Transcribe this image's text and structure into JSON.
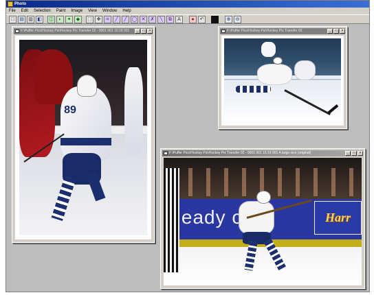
{
  "app": {
    "title": "Photo",
    "menu": [
      "File",
      "Edit",
      "Selection",
      "Paint",
      "Image",
      "View",
      "Window",
      "Help"
    ]
  },
  "toolbar": {
    "buttons": [
      {
        "icon": "new-icon",
        "glyph": "□"
      },
      {
        "icon": "open-icon",
        "glyph": "▤"
      },
      {
        "icon": "print-icon",
        "glyph": "▥"
      },
      {
        "icon": "save-icon",
        "glyph": "◧"
      },
      {
        "icon": "scan-icon",
        "glyph": "◫"
      },
      {
        "icon": "color-icon",
        "glyph": "◐"
      },
      {
        "icon": "effects-icon",
        "glyph": "✦"
      },
      {
        "icon": "filter-icon",
        "glyph": "◆"
      },
      {
        "icon": "select-icon",
        "glyph": "⬚"
      },
      {
        "icon": "move-icon",
        "glyph": "✥"
      },
      {
        "icon": "crop-icon",
        "glyph": "⌗"
      },
      {
        "icon": "paint-icon",
        "glyph": "╱"
      },
      {
        "icon": "brush-icon",
        "glyph": "╱"
      },
      {
        "icon": "lasso-icon",
        "glyph": "◯"
      },
      {
        "icon": "erase-icon",
        "glyph": "✕"
      },
      {
        "icon": "clone-icon",
        "glyph": "✗"
      },
      {
        "icon": "line-icon",
        "glyph": "╲"
      },
      {
        "icon": "stamp-icon",
        "glyph": "⧉"
      },
      {
        "icon": "text-icon",
        "glyph": "A"
      },
      {
        "icon": "red-eye-icon",
        "glyph": "●"
      },
      {
        "icon": "undo-icon",
        "glyph": "↶"
      },
      {
        "icon": "black-fill-icon",
        "glyph": ""
      },
      {
        "icon": "zoom-in-icon",
        "glyph": "⊕"
      },
      {
        "icon": "zoom-out-icon",
        "glyph": "⊖"
      }
    ]
  },
  "windows": [
    {
      "title": "F:\\Puffer Pics\\Hockey Pix\\Hockey Pix Transfer 02 - 0001 001 15:19 001",
      "active": false
    },
    {
      "title": "F:\\Puffer Pics\\Hockey Pix\\Hockey Pix Transfer 02",
      "active": false
    },
    {
      "title": "F:\\Puffer Pics\\Hockey Pix\\Hockey Pix Transfer 02 - 0001 001 15:19 001 A large-size (original)",
      "active": true
    }
  ],
  "window_buttons": {
    "minimize": "_",
    "maximize": "□",
    "close": "×"
  },
  "photo_text": {
    "jersey_number": "89",
    "banner": "eady co",
    "banner_logo": "Harr"
  }
}
